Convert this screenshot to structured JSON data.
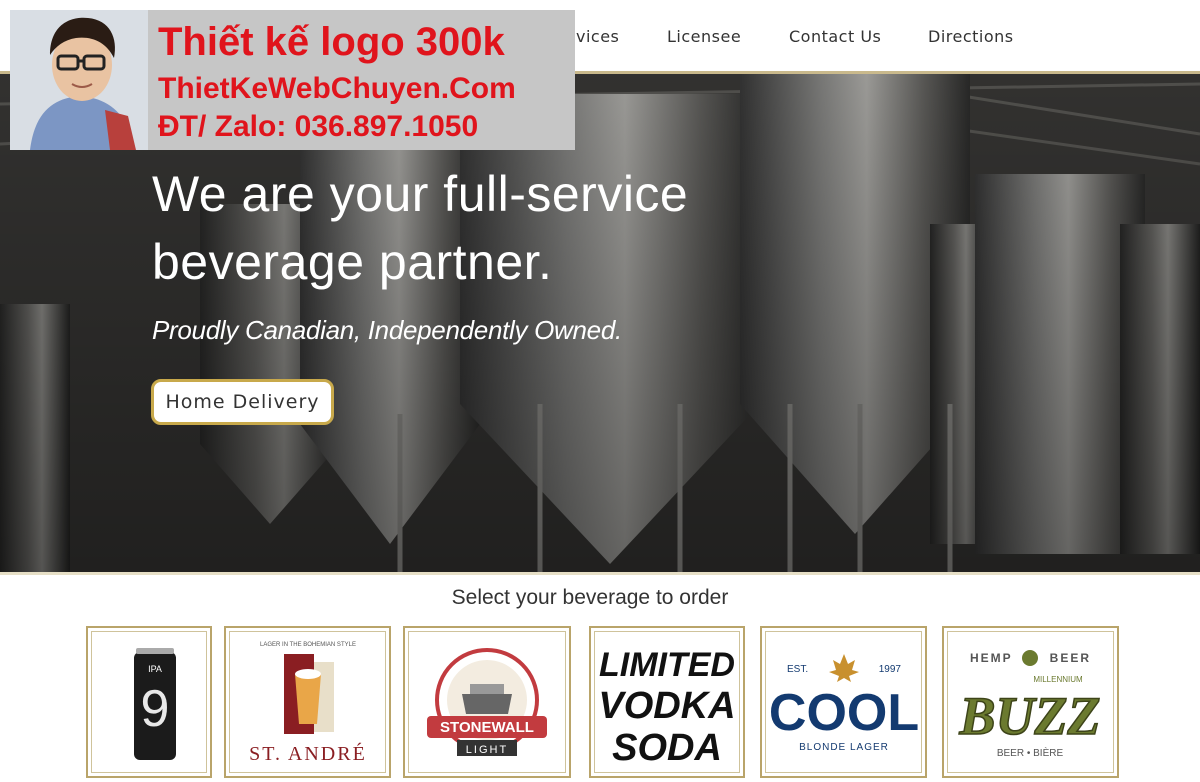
{
  "nav": {
    "items": [
      "vices",
      "Licensee",
      "Contact Us",
      "Directions"
    ]
  },
  "promo": {
    "line1": "Thiết kế logo 300k",
    "line2": "ThietKeWebChuyen.Com",
    "line3": "ĐT/ Zalo: 036.897.1050"
  },
  "hero": {
    "title_line1": "We are your full-service",
    "title_line2": "beverage partner.",
    "subtitle": "Proudly Canadian, Independently Owned.",
    "cta_label": "Home Delivery"
  },
  "section": {
    "title": "Select your beverage to order"
  },
  "brands": [
    {
      "name": "IPA 9",
      "top": "IPA",
      "main": "9"
    },
    {
      "name": "St. André",
      "top": "LAGER IN THE BOHEMIAN STYLE",
      "main": "ST. ANDRÉ"
    },
    {
      "name": "Stonewall Light",
      "top": "STONEWALL",
      "main": "LIGHT"
    },
    {
      "name": "Limited Vodka Soda",
      "line1": "LIMITED",
      "line2": "VODKA",
      "line3": "SODA"
    },
    {
      "name": "Cool Blonde Lager",
      "est": "EST.",
      "year": "1997",
      "main": "COOL",
      "sub": "BLONDE LAGER"
    },
    {
      "name": "Millennium Buzz",
      "left": "HEMP",
      "right": "BEER",
      "arc": "MILLENNIUM",
      "main": "BUZZ",
      "sub": "BEER • BIÈRE"
    }
  ],
  "colors": {
    "accent_gold": "#c8a94b",
    "promo_red": "#e0141c",
    "promo_bg": "#c6c6c6",
    "cool_blue": "#133a70",
    "buzz_green": "#6b7a2f"
  }
}
